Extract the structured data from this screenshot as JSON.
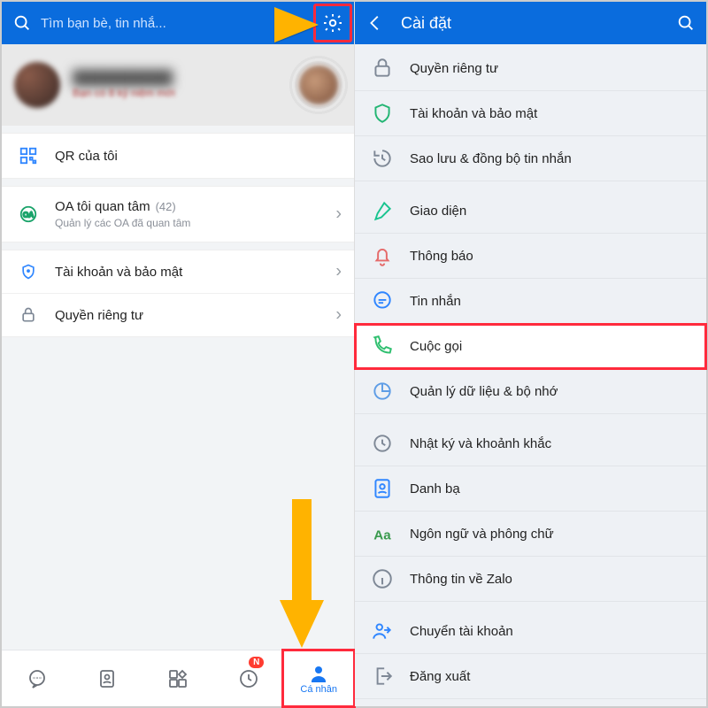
{
  "left": {
    "search_placeholder": "Tìm bạn bè, tin nhắ...",
    "profile_status": "Bạn có 8 kỷ niệm mới",
    "qr": "QR của tôi",
    "oa_title": "OA tôi quan tâm",
    "oa_count": "(42)",
    "oa_sub": "Quản lý các OA đã quan tâm",
    "security": "Tài khoản và bảo mật",
    "privacy": "Quyền riêng tư",
    "nav": {
      "badge": "N",
      "personal": "Cá nhân"
    }
  },
  "right": {
    "title": "Cài đặt",
    "items": [
      {
        "label": "Quyền riêng tư",
        "icon": "lock",
        "color": "#7e8896"
      },
      {
        "label": "Tài khoản và bảo mật",
        "icon": "shield",
        "color": "#22b573"
      },
      {
        "label": "Sao lưu & đồng bộ tin nhắn",
        "icon": "history",
        "color": "#7e8896"
      },
      {
        "label": "Giao diện",
        "icon": "brush",
        "color": "#19c48f",
        "gapBefore": true
      },
      {
        "label": "Thông báo",
        "icon": "bell",
        "color": "#e56a6a"
      },
      {
        "label": "Tin nhắn",
        "icon": "msg",
        "color": "#2f86ff"
      },
      {
        "label": "Cuộc gọi",
        "icon": "phone",
        "color": "#2fbf6f",
        "highlight": true
      },
      {
        "label": "Quản lý dữ liệu & bộ nhớ",
        "icon": "pie",
        "color": "#5e9de6"
      },
      {
        "label": "Nhật ký và khoảnh khắc",
        "icon": "clock",
        "color": "#7e8896",
        "gapBefore": true
      },
      {
        "label": "Danh bạ",
        "icon": "contact",
        "color": "#2f86ff"
      },
      {
        "label": "Ngôn ngữ và phông chữ",
        "icon": "aa",
        "color": "#3a9a4e"
      },
      {
        "label": "Thông tin về Zalo",
        "icon": "info",
        "color": "#7e8896"
      },
      {
        "label": "Chuyển tài khoản",
        "icon": "switch",
        "color": "#2f86ff",
        "gapBefore": true
      },
      {
        "label": "Đăng xuất",
        "icon": "logout",
        "color": "#7e8896"
      }
    ]
  }
}
